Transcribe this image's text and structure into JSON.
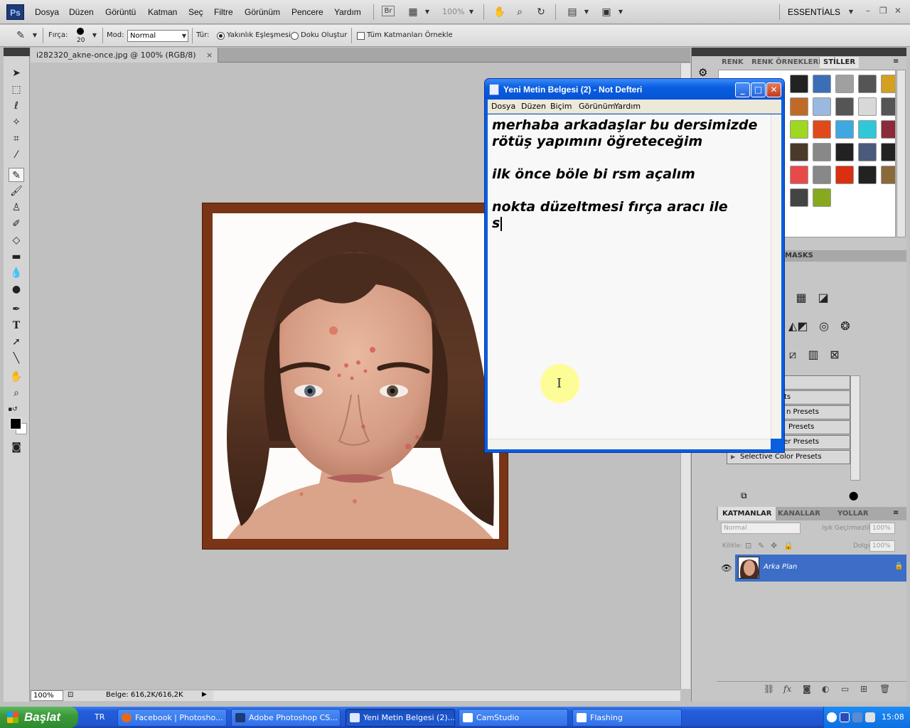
{
  "photoshop": {
    "logo": "Ps",
    "menu": [
      "Dosya",
      "Düzen",
      "Görüntü",
      "Katman",
      "Seç",
      "Filtre",
      "Görünüm",
      "Pencere",
      "Yardım"
    ],
    "zoom_label": "100%",
    "workspace": "ESSENTİALS",
    "options": {
      "brush_label": "Fırça:",
      "brush_size": "20",
      "mode_label": "Mod:",
      "mode_value": "Normal",
      "type_label": "Tür:",
      "type_option_1": "Yakınlık Eşleşmesi",
      "type_option_2": "Doku Oluştur",
      "sample_all": "Tüm Katmanları Örnekle"
    },
    "document": {
      "tab_title": "i282320_akne-once.jpg @ 100% (RGB/8)",
      "close": "×",
      "status_zoom": "100%",
      "status_info": "Belge: 616,2K/616,2K"
    },
    "panels": {
      "top_tabs": [
        "RENK",
        "RENK ÖRNEKLERİ",
        "STİLLER"
      ],
      "masks_tab": "MASKS",
      "presets": [
        "Channel Mixer Presets",
        "Selective Color Presets"
      ],
      "presets_partial": [
        "ts",
        "n Presets",
        "Presets"
      ],
      "layers_tabs": [
        "KATMANLAR",
        "KANALLAR",
        "YOLLAR"
      ],
      "blend_mode": "Normal",
      "opacity_label": "Işık Geçirmezlik:",
      "opacity_value": "100%",
      "lock_label": "Kilitle:",
      "fill_label": "Dolgu:",
      "fill_value": "100%",
      "layer_name": "Arka Plan"
    },
    "style_swatch_colors": [
      "#222222",
      "#3a6fb8",
      "#a0a0a0",
      "#555555",
      "#d4a020",
      "#c06a2a",
      "#9ab8e0",
      "#555555",
      "#d8d8d8",
      "#555555",
      "#9fd820",
      "#e04a1a",
      "#40a8e0",
      "#30c8d8",
      "#8a2a3a",
      "#4a3a2a",
      "#888888",
      "#222222",
      "#4a5a7a",
      "#222222",
      "#e84a4a",
      "#888888",
      "#d83010",
      "#222222",
      "#8a6a3a",
      "#444444",
      "#88a820"
    ]
  },
  "notepad": {
    "title": "Yeni Metin Belgesi (2) - Not Defteri",
    "menu": [
      "Dosya",
      "Düzen",
      "Biçim",
      "Görünüm",
      "Yardım"
    ],
    "lines": [
      "merhaba arkadaşlar bu dersimizde",
      "rötüş yapımını öğreteceğim",
      "",
      "ilk önce böle bi rsm açalım",
      "",
      "nokta düzeltmesi fırça aracı ile",
      "s"
    ]
  },
  "taskbar": {
    "start": "Başlat",
    "language": "TR",
    "tasks": [
      {
        "label": "Facebook | Photosho...",
        "color": "#e8681a"
      },
      {
        "label": "Adobe Photoshop CS...",
        "color": "#1e3a78"
      },
      {
        "label": "Yeni Metin Belgesi (2)...",
        "color": "#dde8ff"
      },
      {
        "label": "CamStudio",
        "color": "#ffffff"
      },
      {
        "label": "Flashing",
        "color": "#ffffff"
      }
    ],
    "clock": "15:08"
  }
}
